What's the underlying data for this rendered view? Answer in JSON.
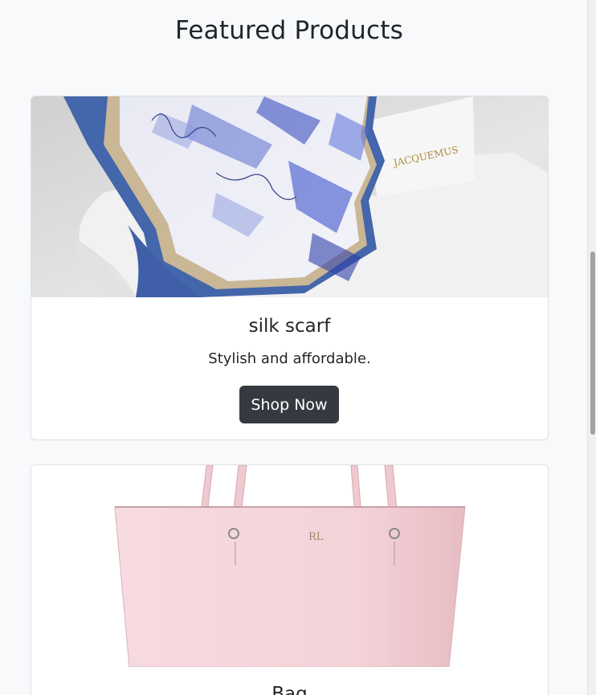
{
  "page": {
    "title": "Featured Products"
  },
  "products": [
    {
      "title": "silk scarf",
      "description": "Stylish and affordable.",
      "button_label": "Shop Now",
      "box_label": "JACQUEMUS"
    },
    {
      "title": "Bag",
      "logo_label": "RL"
    }
  ],
  "colors": {
    "background": "#f8f9fa",
    "button": "#343a40",
    "scarf_blue": "#4466aa",
    "bag_pink": "#f3d3d8"
  }
}
